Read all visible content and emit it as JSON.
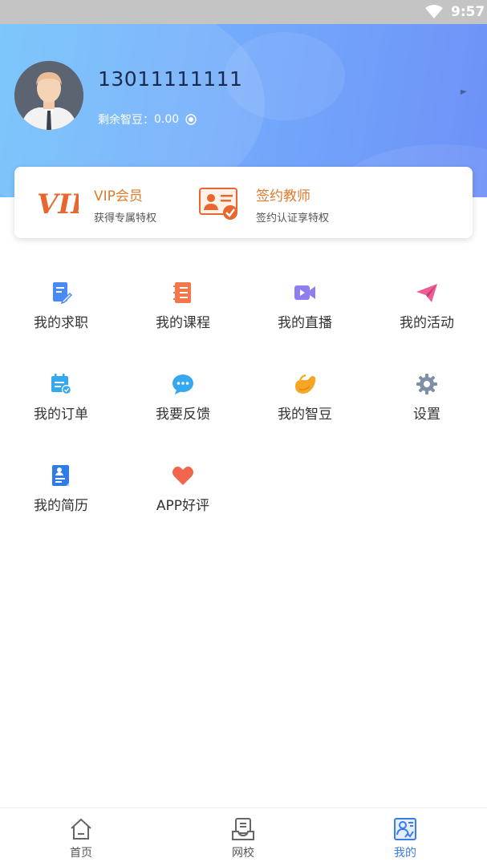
{
  "status_bar": {
    "time": "9:57"
  },
  "profile": {
    "phone": "13011111111",
    "beans_label": "剩余智豆：",
    "beans_value": "0.00"
  },
  "cards": [
    {
      "title": "VIP会员",
      "subtitle": "获得专属特权",
      "icon": "vip-icon",
      "icon_text": "VIP"
    },
    {
      "title": "签约教师",
      "subtitle": "签约认证享特权",
      "icon": "certificate-icon"
    }
  ],
  "grid": [
    {
      "label": "我的求职",
      "icon": "edit-document-icon",
      "color": "#4a8af4"
    },
    {
      "label": "我的课程",
      "icon": "notebook-icon",
      "color": "#f2784b"
    },
    {
      "label": "我的直播",
      "icon": "video-camera-icon",
      "color": "#8f7ef0"
    },
    {
      "label": "我的活动",
      "icon": "paper-plane-icon",
      "color": "#ef5b93"
    },
    {
      "label": "我的订单",
      "icon": "calendar-check-icon",
      "color": "#35a8ef"
    },
    {
      "label": "我要反馈",
      "icon": "chat-bubble-icon",
      "color": "#35a8ef"
    },
    {
      "label": "我的智豆",
      "icon": "bean-icon",
      "color": "#f5a623"
    },
    {
      "label": "设置",
      "icon": "gear-icon",
      "color": "#7d90a8"
    },
    {
      "label": "我的简历",
      "icon": "resume-icon",
      "color": "#2f7be8"
    },
    {
      "label": "APP好评",
      "icon": "heart-icon",
      "color": "#f2664e"
    }
  ],
  "tabs": [
    {
      "label": "首页",
      "icon": "home-icon",
      "active": false
    },
    {
      "label": "网校",
      "icon": "online-school-icon",
      "active": false
    },
    {
      "label": "我的",
      "icon": "profile-icon",
      "active": true
    }
  ],
  "colors": {
    "accent": "#3b7bea",
    "card_title": "#e07b2c",
    "header_start": "#6fc1fb",
    "header_end": "#6e91f7"
  }
}
